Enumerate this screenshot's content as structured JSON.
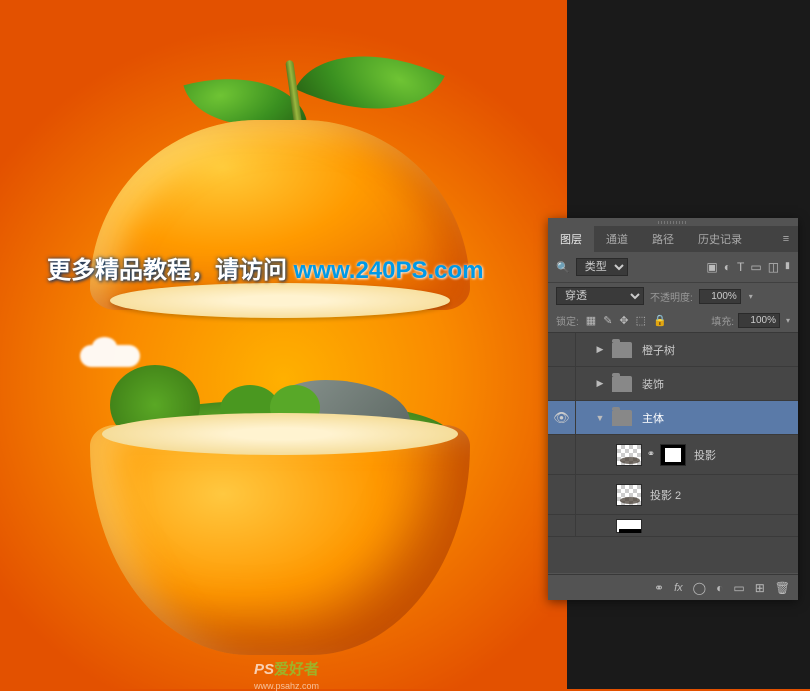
{
  "watermark": {
    "prefix": "更多精品教程，请访问",
    "url": "www.240PS.com"
  },
  "corner_watermark": {
    "brand_prefix": "PS",
    "brand_suffix": "爱好者",
    "url": "www.psahz.com"
  },
  "panel": {
    "tabs": {
      "layers": "图层",
      "channels": "通道",
      "paths": "路径",
      "history": "历史记录"
    },
    "filter": {
      "search_placeholder": "",
      "kind_label": "类型",
      "icons": {
        "image": "image-filter-icon",
        "adjustment": "adjustment-filter-icon",
        "type": "type-filter-icon",
        "shape": "shape-filter-icon",
        "smart": "smart-filter-icon"
      }
    },
    "blend": {
      "mode": "穿透",
      "opacity_label": "不透明度:",
      "opacity_value": "100%"
    },
    "lock": {
      "label": "锁定:",
      "fill_label": "填充:",
      "fill_value": "100%"
    },
    "layers": [
      {
        "type": "group",
        "name": "橙子树",
        "visible": false,
        "expanded": false,
        "selected": false,
        "level": 1
      },
      {
        "type": "group",
        "name": "装饰",
        "visible": false,
        "expanded": false,
        "selected": false,
        "level": 1
      },
      {
        "type": "group",
        "name": "主体",
        "visible": true,
        "expanded": true,
        "selected": true,
        "level": 1
      },
      {
        "type": "layer",
        "name": "投影",
        "visible": false,
        "has_mask": true,
        "selected": false,
        "level": 2
      },
      {
        "type": "layer",
        "name": "投影 2",
        "visible": false,
        "has_mask": false,
        "selected": false,
        "level": 2
      },
      {
        "type": "layer",
        "name": "",
        "visible": false,
        "has_mask": false,
        "selected": false,
        "level": 2,
        "partial": true
      }
    ],
    "footer_icons": {
      "link": "link-icon",
      "fx": "fx",
      "mask": "mask-icon",
      "adjustment": "adjustment-icon",
      "group": "group-icon",
      "new": "new-layer-icon",
      "trash": "trash-icon"
    }
  }
}
